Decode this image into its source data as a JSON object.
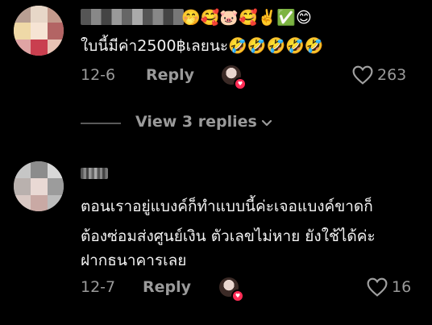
{
  "comments": [
    {
      "emoji_tail": "🤭🥰🐷🥰✌️✅😊",
      "text_lines": [
        "ใบนี้มีค่า2500฿เลยนะ🤣🤣🤣🤣🤣"
      ],
      "date": "12-6",
      "reply_label": "Reply",
      "likes": "263"
    },
    {
      "text_lines": [
        "ตอนเราอยู่แบงค์ก็ทำแบบนี้ค่ะเจอแบงค์ขาดก็",
        "ต้องซ่อมส่งศูนย์เงิน ตัวเลขไม่หาย ยังใช้ได้ค่ะ",
        "ฝากธนาคารเลย"
      ],
      "date": "12-7",
      "reply_label": "Reply",
      "likes": "16"
    }
  ],
  "view_replies": {
    "label": "View 3 replies",
    "icon": "chevron-down-icon"
  },
  "colors": {
    "background": "#000000",
    "text": "#f2f2f2",
    "meta": "#9a9a9a",
    "creator_badge": "#fe2c55"
  },
  "icons": {
    "like": "heart-outline-icon",
    "creator_liked": "heart-badge-icon"
  }
}
